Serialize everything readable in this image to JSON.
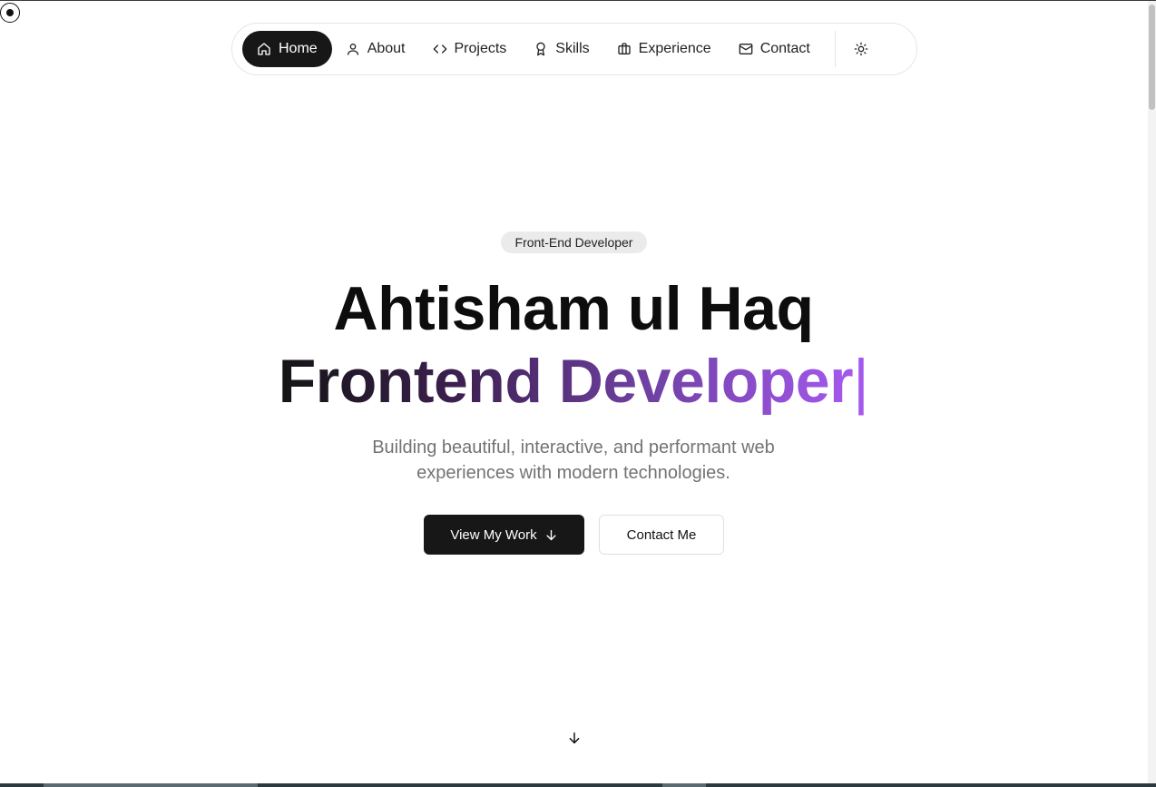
{
  "nav": {
    "items": [
      {
        "label": "Home",
        "icon": "home-icon",
        "active": true
      },
      {
        "label": "About",
        "icon": "user-icon",
        "active": false
      },
      {
        "label": "Projects",
        "icon": "code-icon",
        "active": false
      },
      {
        "label": "Skills",
        "icon": "award-icon",
        "active": false
      },
      {
        "label": "Experience",
        "icon": "briefcase-icon",
        "active": false
      },
      {
        "label": "Contact",
        "icon": "mail-icon",
        "active": false
      }
    ],
    "theme_toggle_icon": "sun-icon"
  },
  "hero": {
    "badge": "Front-End Developer",
    "name": "Ahtisham ul Haq",
    "role": "Frontend Developer",
    "caret": "|",
    "subtitle_line1": "Building beautiful, interactive, and performant web",
    "subtitle_line2": "experiences with modern technologies.",
    "primary_button": "View My Work",
    "secondary_button": "Contact Me",
    "scroll_icon": "arrow-down-icon"
  },
  "colors": {
    "accent_start": "#141414",
    "accent_end": "#a459ee",
    "button_dark": "#171717",
    "muted_text": "#737373"
  }
}
